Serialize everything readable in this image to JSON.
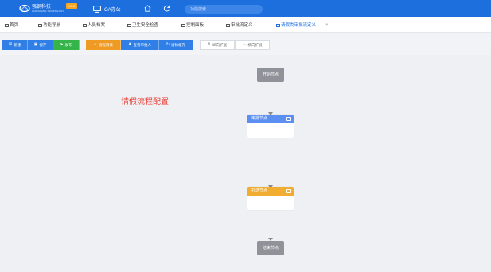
{
  "header": {
    "brand": "强钢科技",
    "brand_sub": "QIANGGANG TECHNOLOGY",
    "version": "V6.0",
    "oa_label": "OA办公",
    "search_placeholder": "功能搜索",
    "accent_color": "#1e6fde"
  },
  "tabs": [
    {
      "label": "首页",
      "active": false
    },
    {
      "label": "功能导航",
      "active": false
    },
    {
      "label": "人员档案",
      "active": false
    },
    {
      "label": "卫生安全检查",
      "active": false
    },
    {
      "label": "控制面板",
      "active": false
    },
    {
      "label": "审批流定义",
      "active": false
    },
    {
      "label": "请假类审批流定义",
      "active": true
    }
  ],
  "tab_close": "×",
  "toolbar": {
    "new": "新建",
    "save": "保存",
    "publish": "发布",
    "test": "流程测试",
    "view_approvers": "查看审批人",
    "clear_cache": "清除缓存",
    "expand_vertical": "纵向扩展",
    "expand_horizontal": "横向扩展"
  },
  "canvas": {
    "title": "请假流程配置",
    "start_node": "开始节点",
    "approve_node": "审批节点",
    "cc_node": "抄送节点",
    "end_node": "结束节点"
  },
  "colors": {
    "approve": "#5b8ff2",
    "cc": "#f1ad32",
    "terminal": "#8f9298",
    "title_red": "#e8433a"
  }
}
